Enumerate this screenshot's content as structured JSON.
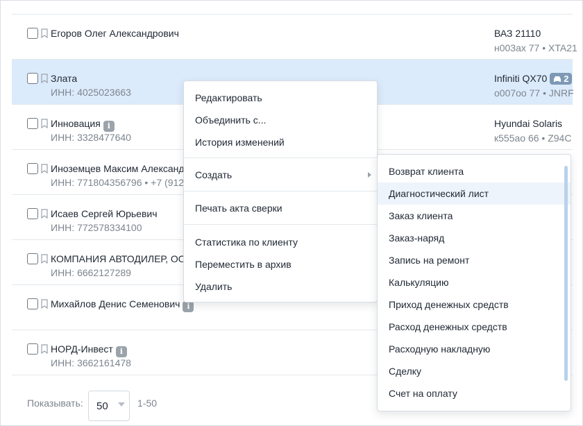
{
  "rows": [
    {
      "name": "Егоров Олег Александрович",
      "sub": "",
      "car": "ВАЗ 21110",
      "plate": "н003ах 77 • XTA21"
    },
    {
      "name": "Злата",
      "sub": "ИНН: 4025023663",
      "car": "Infiniti QX70",
      "badge": "2",
      "plate": "о007оо 77 • JNRF"
    },
    {
      "name": "Инновация",
      "sub": "ИНН: 3328477640",
      "car": "Hyundai Solaris",
      "plate": "к555ао 66 • Z94C"
    },
    {
      "name": "Иноземцев Максим Александ",
      "sub": "ИНН: 771804356796 • +7 (912)",
      "car": "",
      "plate": ""
    },
    {
      "name": "Исаев Сергей Юрьевич",
      "sub": "ИНН: 772578334100",
      "car": "",
      "plate": ""
    },
    {
      "name": "КОМПАНИЯ АВТОДИЛЕР, ООО",
      "sub": "ИНН: 6662127289",
      "car": "",
      "plate": ""
    },
    {
      "name": "Михайлов Денис Семенович",
      "sub": "",
      "car": "",
      "plate": ""
    },
    {
      "name": "НОРД-Инвест",
      "sub": "ИНН: 3662161478",
      "car": "",
      "plate": ""
    }
  ],
  "context_menu": {
    "edit": "Редактировать",
    "merge": "Объединить с...",
    "history": "История изменений",
    "create": "Создать",
    "print": "Печать акта сверки",
    "stats": "Статистика по клиенту",
    "archive": "Переместить в архив",
    "delete": "Удалить"
  },
  "submenu": [
    "Возврат клиента",
    "Диагностический лист",
    "Заказ клиента",
    "Заказ-наряд",
    "Запись на ремонт",
    "Калькуляцию",
    "Приход денежных средств",
    "Расход денежных средств",
    "Расходную накладную",
    "Сделку",
    "Счет на оплату"
  ],
  "pager": {
    "label": "Показывать:",
    "page_size": "50",
    "range": "1-50"
  },
  "colors": {
    "selected_row": "#dcebfb",
    "scroll_thumb": "#b9d2ec",
    "badge": "#7e99b5"
  }
}
